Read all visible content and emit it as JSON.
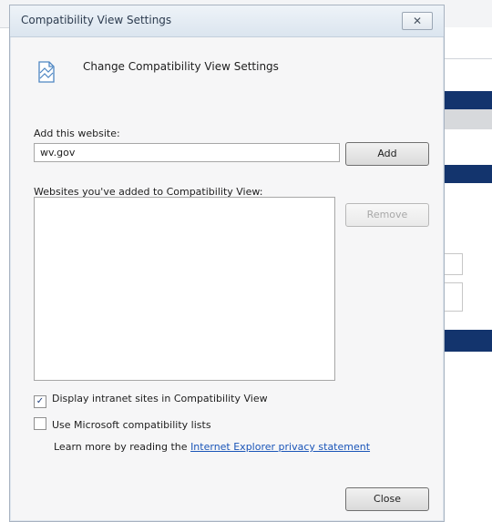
{
  "dialog": {
    "title": "Compatibility View Settings",
    "close_glyph": "☒",
    "header_text": "Change Compatibility View Settings",
    "add_label": "Add this website:",
    "website_value": "wv.gov",
    "add_button": "Add",
    "list_label": "Websites you've added to Compatibility View:",
    "remove_button": "Remove",
    "intranet_label": "Display intranet sites in Compatibility View",
    "intranet_checked": true,
    "ms_lists_label": "Use Microsoft compatibility lists",
    "ms_lists_checked": false,
    "learn_prefix": "Learn more by reading the",
    "learn_link": "Internet Explorer privacy statement",
    "close_button": "Close"
  },
  "colors": {
    "nav_band": "#13346d",
    "link": "#1a55b8"
  }
}
